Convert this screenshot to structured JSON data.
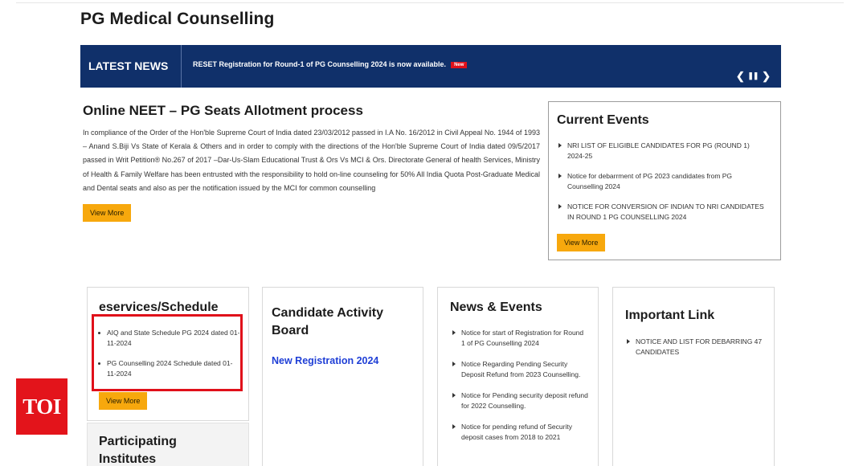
{
  "page": {
    "title": "PG Medical Counselling"
  },
  "news_bar": {
    "label": "LATEST NEWS",
    "ticker_text": "RESET Registration for Round-1 of PG Counselling 2024 is now available.",
    "badge": "New",
    "prev_symbol": "❮",
    "pause_symbol": "❚❚",
    "next_symbol": "❯"
  },
  "allotment": {
    "title": "Online NEET – PG Seats Allotment process",
    "body": "In compliance of the Order of the Hon'ble Supreme Court of India dated 23/03/2012 passed in I.A No. 16/2012 in Civil Appeal No. 1944 of 1993 – Anand S.Biji Vs State of Kerala & Others and in order to comply with the directions of the Hon'ble Supreme Court of India dated 09/5/2017 passed in Writ Petition® No.267 of 2017 –Dar-Us-Slam Educational Trust & Ors Vs MCI & Ors. Directorate General of health Services, Ministry of Health & Family Welfare has been entrusted with the responsibility to hold on-line counseling for 50% All India Quota Post-Graduate Medical and Dental seats and also as per the notification issued by the MCI for common counselling",
    "view_more": "View More"
  },
  "current_events": {
    "title": "Current Events",
    "items": [
      "NRI LIST OF ELIGIBLE CANDIDATES FOR PG (ROUND 1) 2024-25",
      "Notice for debarrment of PG 2023 candidates from PG Counselling 2024",
      "NOTICE FOR CONVERSION OF INDIAN TO NRI CANDIDATES IN ROUND 1 PG COUNSELLING 2024"
    ],
    "view_more": "View More"
  },
  "eservices": {
    "title": "eservices/Schedule",
    "items": [
      "AIQ and State Schedule PG 2024 dated 01-11-2024",
      "PG Counselling 2024 Schedule dated 01-11-2024"
    ],
    "view_more": "View More"
  },
  "participating": {
    "title": "Participating Institutes"
  },
  "candidate_board": {
    "title": "Candidate Activity Board",
    "link": "New Registration 2024"
  },
  "news_events": {
    "title": "News & Events",
    "items": [
      "Notice for start of Registration for Round 1 of PG Counselling 2024",
      "Notice Regarding Pending Security Deposit Refund from 2023 Counselling.",
      "Notice for Pending security deposit refund for 2022 Counselling.",
      "Notice for pending refund of Security deposit cases from 2018 to 2021"
    ]
  },
  "important_link": {
    "title": "Important Link",
    "items": [
      "NOTICE AND LIST FOR DEBARRING 47 CANDIDATES"
    ]
  },
  "watermark": {
    "text": "TOI"
  },
  "colors": {
    "navy": "#10306a",
    "accent_yellow": "#f7a80d",
    "badge_red": "#e0101a",
    "link_blue": "#1f3fd6",
    "toi_red": "#e3141b"
  }
}
